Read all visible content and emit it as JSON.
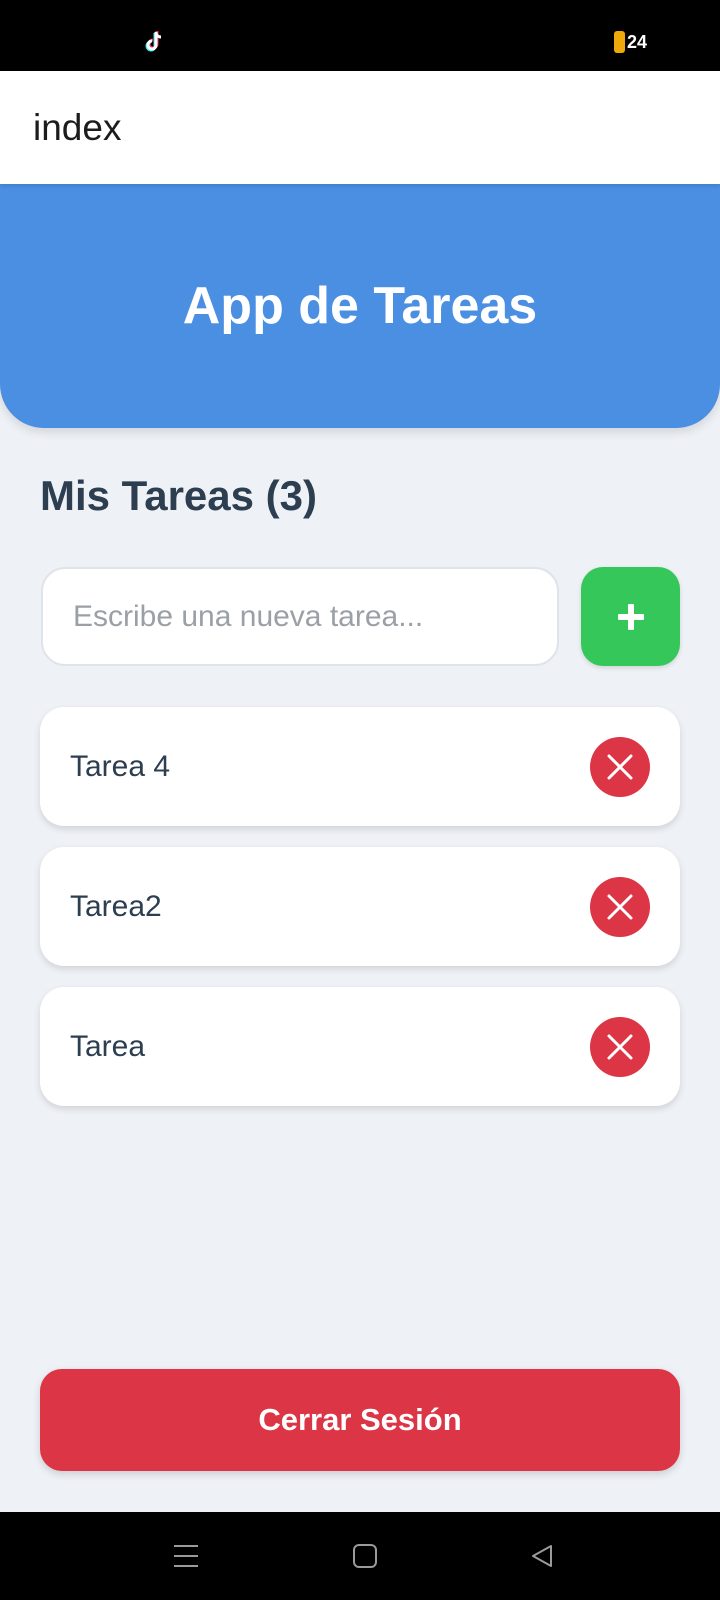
{
  "status_bar": {
    "app_icon": "tiktok-icon",
    "battery_level": "24",
    "battery_color": "#f0a90b"
  },
  "header": {
    "title": "index"
  },
  "hero": {
    "title": "App de Tareas",
    "color": "#4a8fe2"
  },
  "tasks_section": {
    "title": "Mis Tareas (3)",
    "input_placeholder": "Escribe una nueva tarea...",
    "input_value": "",
    "add_button_icon": "plus-icon",
    "add_button_color": "#35c75a",
    "delete_icon": "close-icon",
    "delete_color": "#dc3545"
  },
  "tasks": [
    {
      "label": "Tarea 4"
    },
    {
      "label": "Tarea2"
    },
    {
      "label": "Tarea"
    }
  ],
  "logout_button": {
    "label": "Cerrar Sesión",
    "color": "#dc3545"
  },
  "nav_bar": {
    "icons": [
      "menu-icon",
      "home-icon",
      "back-icon"
    ]
  }
}
